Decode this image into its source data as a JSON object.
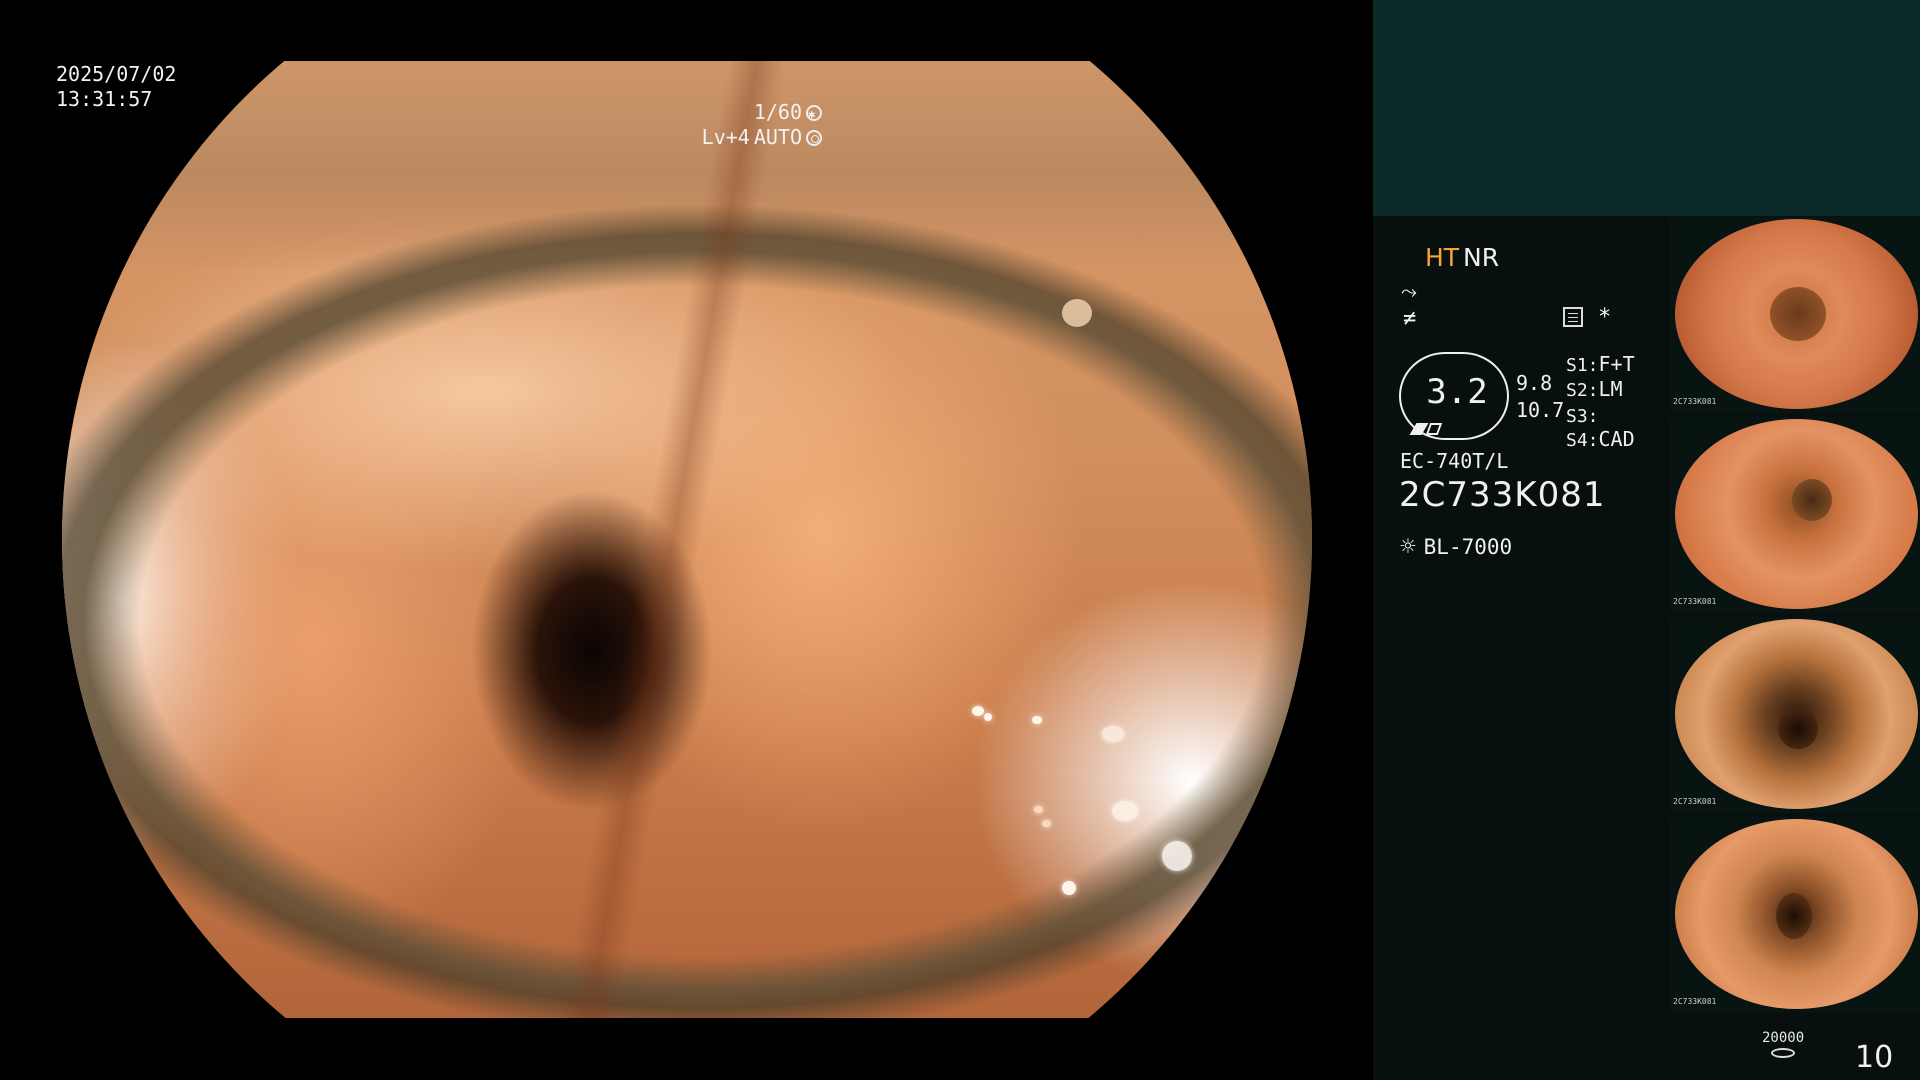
{
  "overlay": {
    "date": "2025/07/02",
    "time": "13:31:57",
    "shutter": "1/60",
    "level": "Lv+4",
    "auto": "AUTO"
  },
  "panel": {
    "mode_ht": "HT",
    "mode_nr": "NR",
    "enhance_icon_1": "enhancement-curve-icon",
    "enhance_icon_2": "filter-icon",
    "star": "*",
    "zoom": "3.2",
    "zoom_sub1": "9.8",
    "zoom_sub2": "10.7",
    "slots": [
      {
        "key": "S1:",
        "value": "F+T"
      },
      {
        "key": "S2:",
        "value": "LM"
      },
      {
        "key": "S3:",
        "value": ""
      },
      {
        "key": "S4:",
        "value": "CAD"
      }
    ],
    "model": "EC-740T/L",
    "serial": "2C733K081",
    "light_source": "BL-7000"
  },
  "thumbnails": {
    "label": "2C733K081"
  },
  "storage": {
    "capacity": "20000",
    "count": "10"
  },
  "colors": {
    "panel_top": "#0c2a29",
    "panel_bg": "#07100f",
    "ht_accent": "#f0a63a"
  }
}
